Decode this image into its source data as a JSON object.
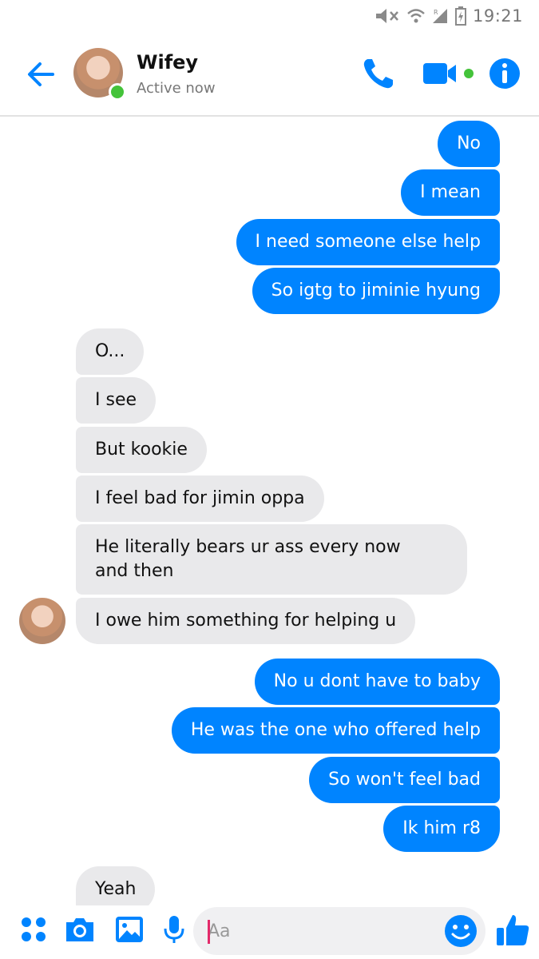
{
  "status_bar": {
    "time": "19:21"
  },
  "header": {
    "contact_name": "Wifey",
    "contact_status": "Active now"
  },
  "messages": [
    {
      "side": "out",
      "text": "No"
    },
    {
      "side": "out",
      "text": "I mean"
    },
    {
      "side": "out",
      "text": "I need someone else help"
    },
    {
      "side": "out",
      "text": "So igtg to jiminie hyung"
    },
    {
      "side": "in",
      "text": "O..."
    },
    {
      "side": "in",
      "text": "I see"
    },
    {
      "side": "in",
      "text": "But kookie"
    },
    {
      "side": "in",
      "text": "I feel bad for jimin oppa"
    },
    {
      "side": "in",
      "text": "He literally bears ur ass every now"
    },
    {
      "side": "in",
      "text": "and then"
    },
    {
      "side": "in",
      "text": "I owe him something for helping u"
    },
    {
      "side": "out",
      "text": "No u dont have to baby"
    },
    {
      "side": "out",
      "text": "He was the one who offered help"
    },
    {
      "side": "out",
      "text": "So won't feel bad"
    },
    {
      "side": "out",
      "text": "Ik him r8"
    },
    {
      "side": "in",
      "text": "Yeah"
    }
  ],
  "composer": {
    "placeholder": "Aa"
  },
  "colors": {
    "accent": "#0084ff",
    "active": "#44c33a",
    "incoming_bubble": "#e9e9eb"
  },
  "icons": {
    "back": "arrow-left-icon",
    "call": "phone-icon",
    "video": "video-camera-icon",
    "info": "info-icon",
    "apps": "four-dots-icon",
    "camera": "camera-icon",
    "gallery": "image-icon",
    "mic": "microphone-icon",
    "emoji": "smiley-icon",
    "like": "thumbs-up-icon"
  }
}
